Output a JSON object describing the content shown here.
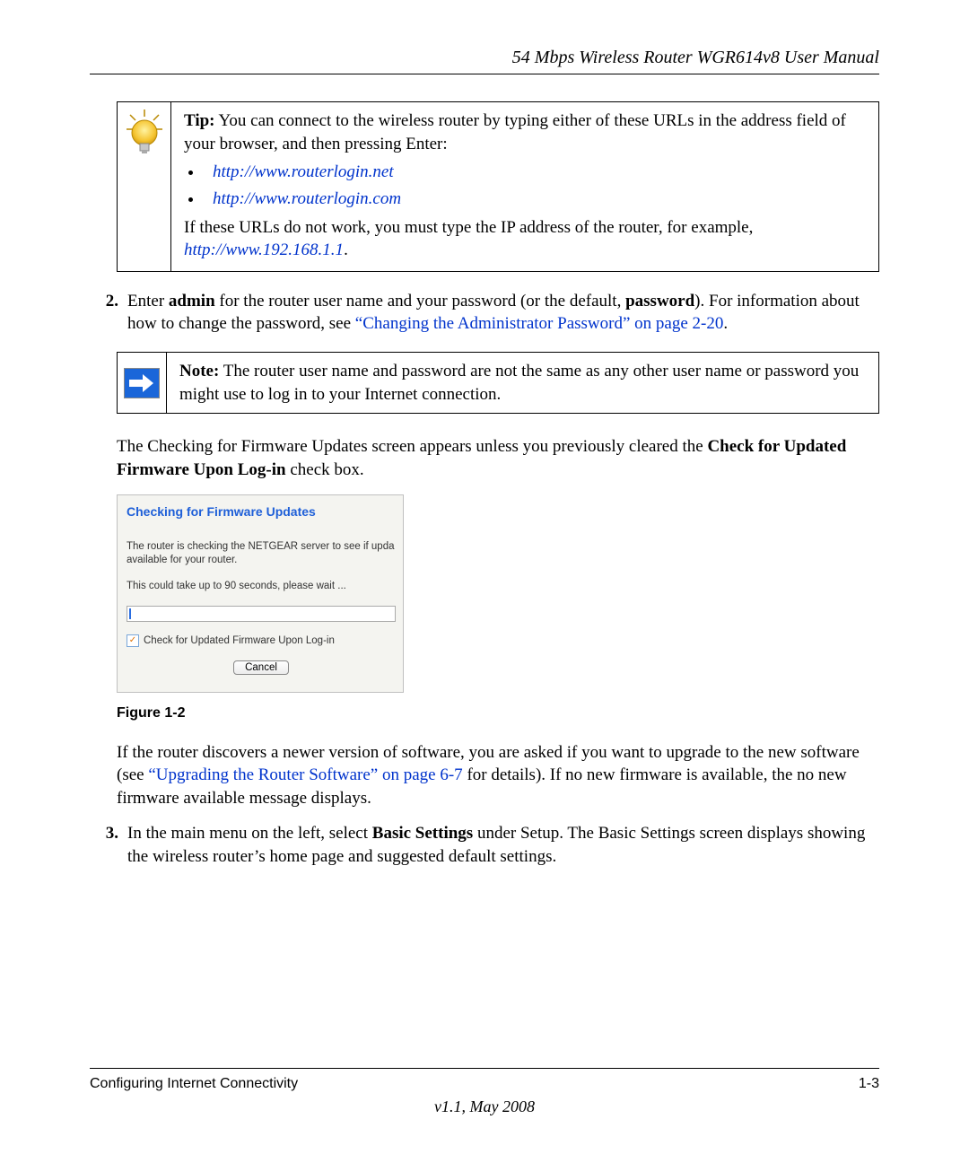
{
  "header": {
    "title": "54 Mbps Wireless Router WGR614v8 User Manual"
  },
  "tip": {
    "label": "Tip:",
    "intro": " You can connect to the wireless router by typing either of these URLs in the address field of your browser, and then pressing Enter:",
    "links": [
      "http://www.routerlogin.net",
      "http://www.routerlogin.com"
    ],
    "followup_pre": "If these URLs do not work, you must type the IP address of the router, for example, ",
    "followup_link": "http://www.192.168.1.1",
    "followup_post": "."
  },
  "step2": {
    "num": "2.",
    "t1": "Enter ",
    "t2": "admin",
    "t3": " for the router user name and your password (or the default, ",
    "t4": "password",
    "t5": "). For information about how to change the password, see ",
    "xref": "“Changing the Administrator Password” on page 2-20",
    "t6": "."
  },
  "note": {
    "label": "Note:",
    "text": " The router user name and password are not the same as any other user name or password you might use to log in to your Internet connection."
  },
  "para_check": {
    "t1": "The Checking for Firmware Updates screen appears unless you previously cleared the ",
    "t2": "Check for Updated Firmware Upon Log-in",
    "t3": " check box."
  },
  "firmware_panel": {
    "title": "Checking for Firmware Updates",
    "line1": "The router is checking the NETGEAR server to see if upda available for your router.",
    "line2": "This could take up to 90 seconds, please wait ...",
    "checkbox_label": "Check for Updated Firmware Upon Log-in",
    "cancel": "Cancel"
  },
  "figure_caption": "Figure 1-2",
  "para_upgrade": {
    "t1": "If the router discovers a newer version of software, you are asked if you want to upgrade to the new software (see ",
    "xref": "“Upgrading the Router Software” on page 6-7",
    "t2": " for details). If no new firmware is available, the no new firmware available message displays."
  },
  "step3": {
    "num": "3.",
    "t1": "In the main menu on the left, select ",
    "t2": "Basic Settings",
    "t3": " under Setup. The Basic Settings screen displays showing the wireless router’s home page and suggested default settings."
  },
  "footer": {
    "section": "Configuring Internet Connectivity",
    "page": "1-3",
    "version": "v1.1, May 2008"
  }
}
